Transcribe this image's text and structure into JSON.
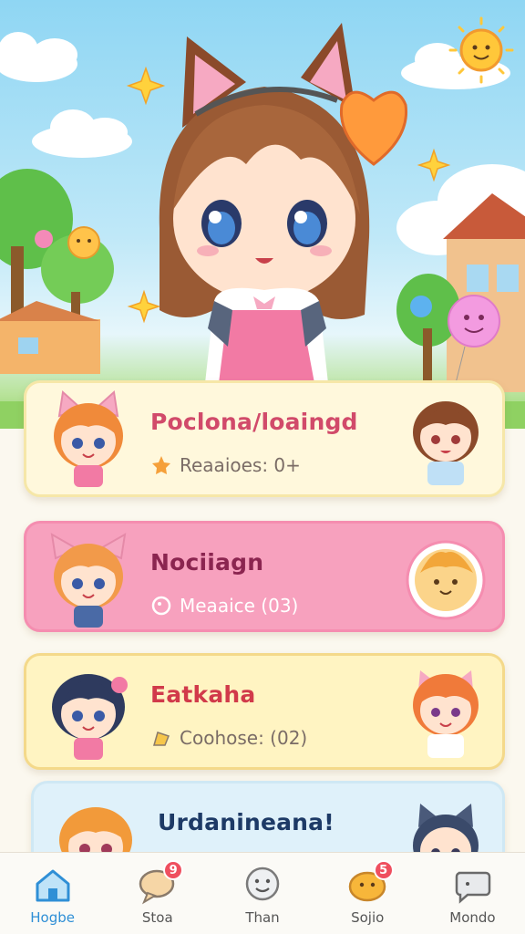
{
  "colors": {
    "accent": "#2f8fd6",
    "pink": "#f7a1be",
    "badge": "#ef4f5f"
  },
  "cards": [
    {
      "title": "Poclona/loaingd",
      "subtitle": "Reaaioes: 0+",
      "icon": "star-icon"
    },
    {
      "title": "Nociiagn",
      "subtitle": "Meaaice (03)",
      "icon": "circle-icon"
    },
    {
      "title": "Eatkaha",
      "subtitle": "Coohose: (02)",
      "icon": "flag-icon"
    },
    {
      "title": "Urdanineana!",
      "subtitle": "",
      "icon": "chat-icon"
    }
  ],
  "nav": [
    {
      "label": "Hogbe",
      "icon": "home-icon",
      "badge": "",
      "active": true
    },
    {
      "label": "Stoa",
      "icon": "chat-bubble-icon",
      "badge": "9",
      "active": false
    },
    {
      "label": "Than",
      "icon": "smiley-icon",
      "badge": "",
      "active": false
    },
    {
      "label": "Sojio",
      "icon": "blob-icon",
      "badge": "5",
      "active": false
    },
    {
      "label": "Mondo",
      "icon": "message-icon",
      "badge": "",
      "active": false
    }
  ]
}
